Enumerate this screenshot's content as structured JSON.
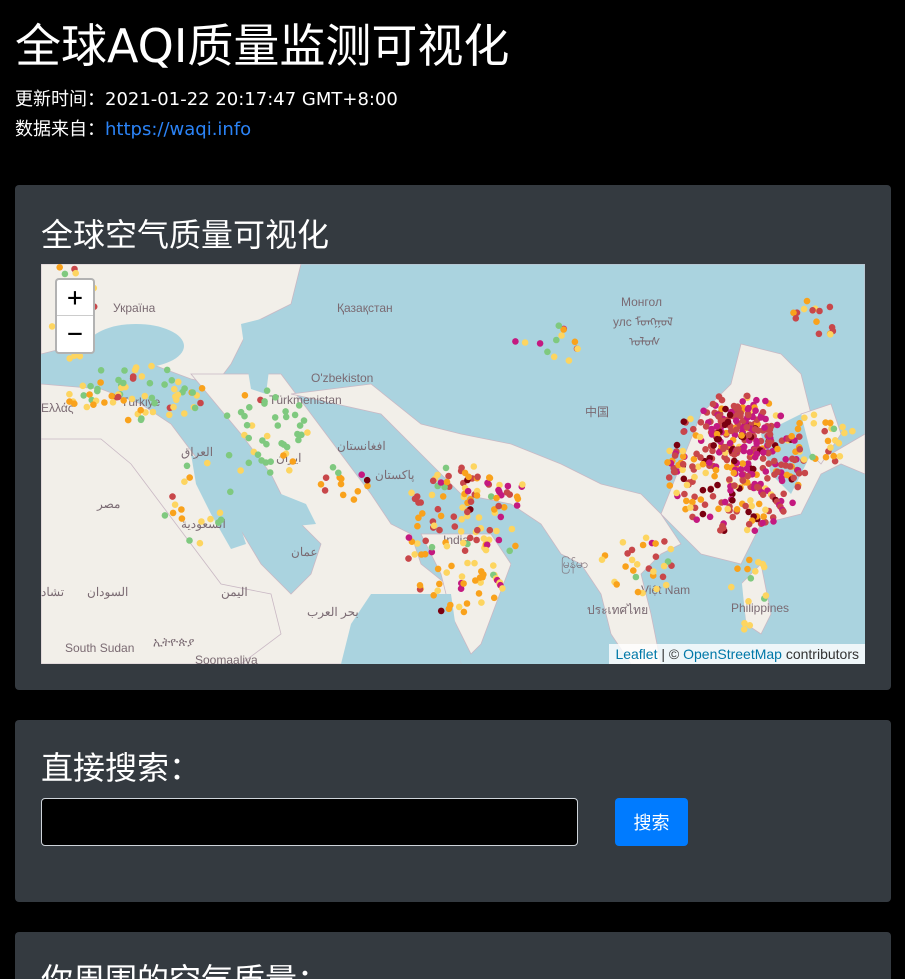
{
  "page": {
    "title": "全球AQI质量监测可视化",
    "update_label": "更新时间：",
    "update_time": "2021-01-22 20:17:47 GMT+8:00",
    "source_label": "数据来自：",
    "source_link": "https://waqi.info"
  },
  "map_card": {
    "heading": "全球空气质量可视化",
    "zoom_in": "+",
    "zoom_out": "−",
    "attribution": {
      "leaflet": "Leaflet",
      "separator": " | © ",
      "osm": "OpenStreetMap",
      "suffix": " contributors"
    },
    "place_labels": [
      "Україна",
      "Қазақстан",
      "Монгол",
      "улс ᠮᠣᠩᠭᠣᠯ",
      "ᠤᠯᠤᠰ",
      "O'zbekiston",
      "Türkmenistan",
      "Türkiye",
      "Ελλάς",
      "中国",
      "العراق",
      "ایران",
      "افغانستان",
      "پاکستان",
      "مصر",
      "السعودية",
      "عمان",
      "India",
      "မြန်မာ",
      "Việt Nam",
      "ประเทศไทย",
      "Philippines",
      "اليمن",
      "السودان",
      "تشاد",
      "بحر العرب",
      "South Sudan",
      "ኢትዮጵያ",
      "Soomaaliya"
    ],
    "aqi_colors": {
      "good": "#7fc97f",
      "moderate": "#fdd560",
      "sensitive": "#f9a21c",
      "unhealthy": "#c8474a",
      "very_unhealthy": "#c41980",
      "hazardous": "#7a0010"
    }
  },
  "search_card": {
    "heading": "直接搜索：",
    "input_value": "",
    "button_label": "搜索"
  },
  "nearby_card": {
    "heading": "你周围的空气质量："
  }
}
